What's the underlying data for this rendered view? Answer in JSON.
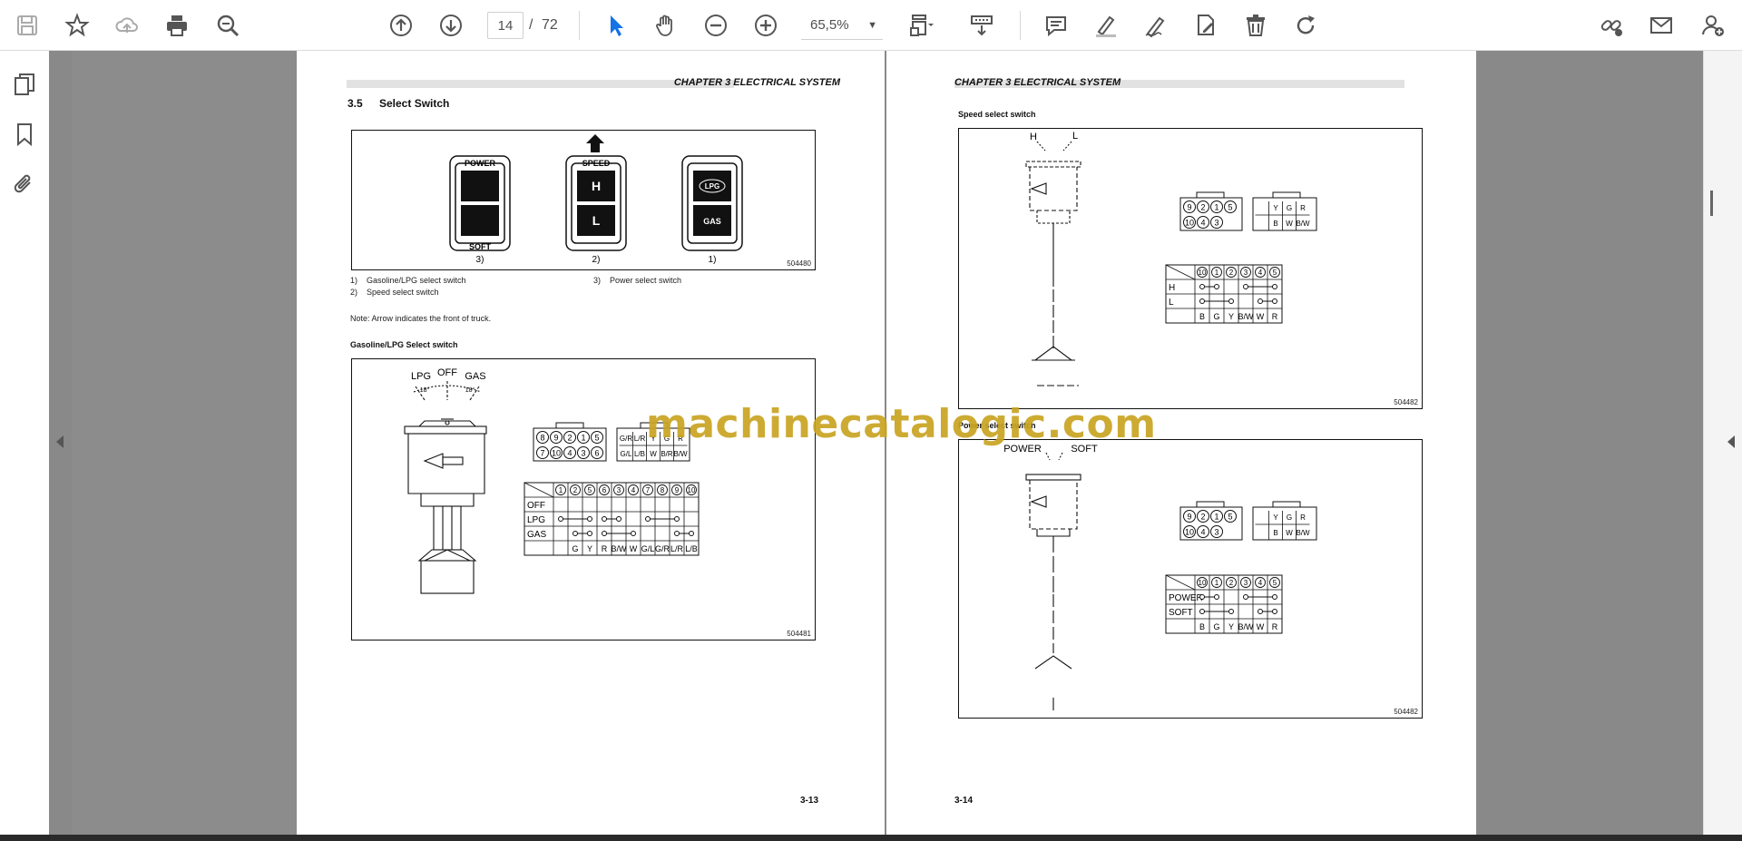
{
  "toolbar": {
    "page_current": "14",
    "page_separator": "/",
    "page_total": "72",
    "zoom": "65,5%",
    "icons": [
      "save-icon",
      "star-icon",
      "cloud-upload-icon",
      "print-icon",
      "zoom-search-icon",
      "page-up-icon",
      "page-down-icon",
      "cursor-icon",
      "hand-icon",
      "zoom-out-icon",
      "zoom-in-icon",
      "fit-page-icon",
      "scroll-mode-icon",
      "comment-icon",
      "highlight-icon",
      "sign-icon",
      "edit-pdf-icon",
      "delete-icon",
      "rotate-icon",
      "link-icon",
      "email-icon",
      "add-user-icon"
    ]
  },
  "sidebar": {
    "icons": [
      "pages-icon",
      "bookmark-icon",
      "attachment-icon"
    ]
  },
  "left_page": {
    "chapter": "CHAPTER 3 ELECTRICAL SYSTEM",
    "section_num": "3.5",
    "section_title": "Select Switch",
    "fig1": {
      "power": "POWER",
      "soft": "SOFT",
      "speed": "SPEED",
      "h": "H",
      "l": "L",
      "lpg": "LPG",
      "gas": "GAS",
      "n3": "3)",
      "n2": "2)",
      "n1": "1)",
      "id": "504480"
    },
    "legend": [
      {
        "num": "1)",
        "text": "Gasoline/LPG select switch"
      },
      {
        "num": "2)",
        "text": "Speed select switch"
      },
      {
        "num": "3)",
        "text": "Power select switch"
      }
    ],
    "note": "Note: Arrow indicates the front of truck.",
    "fig2_title": "Gasoline/LPG Select switch",
    "fig2": {
      "lpg": "LPG",
      "off": "OFF",
      "gas": "GAS",
      "angle": "18°",
      "conn_left_top": [
        "8",
        "9",
        "2",
        "1",
        "5"
      ],
      "conn_left_bot": [
        "7",
        "10",
        "4",
        "3",
        "6"
      ],
      "conn_right_top": [
        "G/R",
        "L/R",
        "Y",
        "G",
        "R"
      ],
      "conn_right_bot": [
        "G/L",
        "L/B",
        "W",
        "B/R",
        "B/W"
      ],
      "table_cols": [
        "1",
        "2",
        "5",
        "6",
        "3",
        "4",
        "7",
        "8",
        "9",
        "10"
      ],
      "table_rows": [
        "OFF",
        "LPG",
        "GAS"
      ],
      "table_colors": [
        "G",
        "Y",
        "R",
        "B/W",
        "W",
        "G/L",
        "G/R",
        "L/R",
        "L/B"
      ],
      "id": "504481"
    },
    "page_num": "3-13"
  },
  "right_page": {
    "chapter": "CHAPTER 3 ELECTRICAL SYSTEM",
    "speed_title": "Speed select switch",
    "speed": {
      "h": "H",
      "l": "L",
      "conn_left_top": [
        "9",
        "2",
        "1",
        "5"
      ],
      "conn_left_bot": [
        "10",
        "4",
        "3"
      ],
      "conn_right_top": [
        "Y",
        "G",
        "R"
      ],
      "conn_right_bot": [
        "B",
        "W",
        "B/W"
      ],
      "table_cols": [
        "10",
        "1",
        "2",
        "3",
        "4",
        "5"
      ],
      "table_rows": [
        "H",
        "L"
      ],
      "table_colors": [
        "B",
        "G",
        "Y",
        "B/W",
        "W",
        "R"
      ],
      "id": "504482"
    },
    "power_title": "Power select switch",
    "power": {
      "power": "POWER",
      "soft": "SOFT",
      "conn_left_top": [
        "9",
        "2",
        "1",
        "5"
      ],
      "conn_left_bot": [
        "10",
        "4",
        "3"
      ],
      "conn_right_top": [
        "Y",
        "G",
        "R"
      ],
      "conn_right_bot": [
        "B",
        "W",
        "B/W"
      ],
      "table_cols": [
        "10",
        "1",
        "2",
        "3",
        "4",
        "5"
      ],
      "table_rows": [
        "POWER",
        "SOFT"
      ],
      "table_colors": [
        "B",
        "G",
        "Y",
        "B/W",
        "W",
        "R"
      ],
      "id": "504482"
    },
    "page_num": "3-14"
  },
  "watermark": "machinecatalogic.com"
}
